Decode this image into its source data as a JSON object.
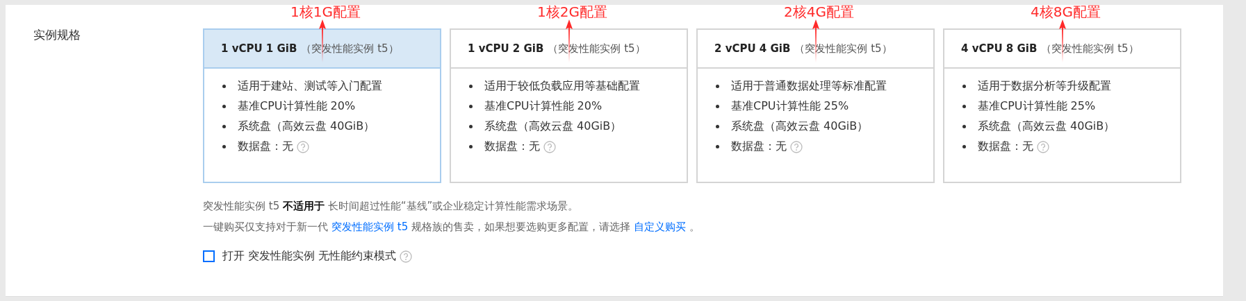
{
  "field_label": "实例规格",
  "cards": [
    {
      "title": "1 vCPU 1 GiB",
      "subtitle": "（突发性能实例 t5）",
      "selected": true,
      "annotation": "1核1G配置",
      "features": [
        "适用于建站、测试等入门配置",
        "基准CPU计算性能 20%",
        "系统盘（高效云盘 40GiB）",
        "数据盘：无"
      ]
    },
    {
      "title": "1 vCPU 2 GiB",
      "subtitle": "（突发性能实例 t5）",
      "selected": false,
      "annotation": "1核2G配置",
      "features": [
        "适用于较低负载应用等基础配置",
        "基准CPU计算性能 20%",
        "系统盘（高效云盘 40GiB）",
        "数据盘：无"
      ]
    },
    {
      "title": "2 vCPU 4 GiB",
      "subtitle": "（突发性能实例 t5）",
      "selected": false,
      "annotation": "2核4G配置",
      "features": [
        "适用于普通数据处理等标准配置",
        "基准CPU计算性能 25%",
        "系统盘（高效云盘 40GiB）",
        "数据盘：无"
      ]
    },
    {
      "title": "4 vCPU 8 GiB",
      "subtitle": "（突发性能实例 t5）",
      "selected": false,
      "annotation": "4核8G配置",
      "features": [
        "适用于数据分析等升级配置",
        "基准CPU计算性能 25%",
        "系统盘（高效云盘 40GiB）",
        "数据盘：无"
      ]
    }
  ],
  "note": "突发性能实例 t5 **不适用于** 长时间超过性能“基线”或企业稳定计算性能需求场景。",
  "purchase_note": [
    {
      "kind": "text",
      "text": "一键购买仅支持对于新一代"
    },
    {
      "kind": "link",
      "text": "突发性能实例 t5"
    },
    {
      "kind": "text",
      "text": "规格族的售卖，如果想要选购更多配置，请选择"
    },
    {
      "kind": "link",
      "text": "自定义购买"
    },
    {
      "kind": "text",
      "text": "。"
    }
  ],
  "unlimited_mode": {
    "label": "打开 突发性能实例 无性能约束模式",
    "checked": false
  }
}
